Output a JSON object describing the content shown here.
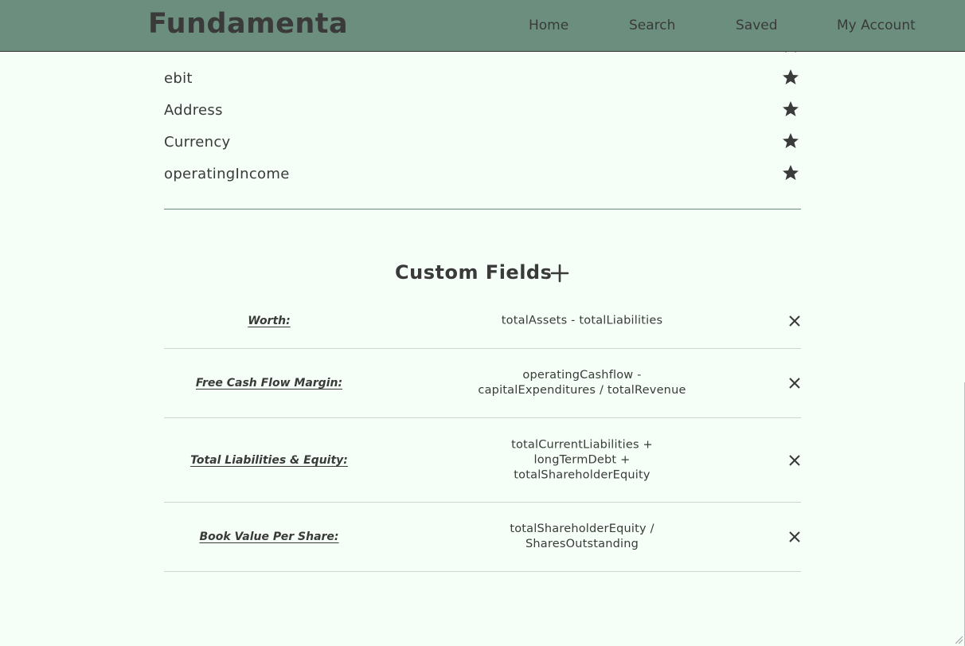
{
  "app": {
    "brand": "Fundamenta"
  },
  "nav": {
    "home": "Home",
    "search": "Search",
    "saved": "Saved",
    "account": "My Account"
  },
  "saved_fields": [
    {
      "label": "ebit"
    },
    {
      "label": "Address"
    },
    {
      "label": "Currency"
    },
    {
      "label": "operatingIncome"
    }
  ],
  "custom_fields": {
    "title": "Custom Fields",
    "items": [
      {
        "name": "Worth:",
        "formula": "totalAssets - totalLiabilities"
      },
      {
        "name": "Free Cash Flow Margin:",
        "formula": "operatingCashflow - capitalExpenditures / totalRevenue"
      },
      {
        "name": "Total Liabilities & Equity:",
        "formula": "totalCurrentLiabilities + longTermDebt + totalShareholderEquity"
      },
      {
        "name": "Book Value Per Share:",
        "formula": "totalShareholderEquity / SharesOutstanding"
      }
    ]
  },
  "icons": {
    "star": "star-icon",
    "add": "plus-icon",
    "remove": "close-icon"
  },
  "colors": {
    "header_bg": "#6b8e7e",
    "page_bg": "#f5fff8",
    "text": "#3a3a3a"
  }
}
